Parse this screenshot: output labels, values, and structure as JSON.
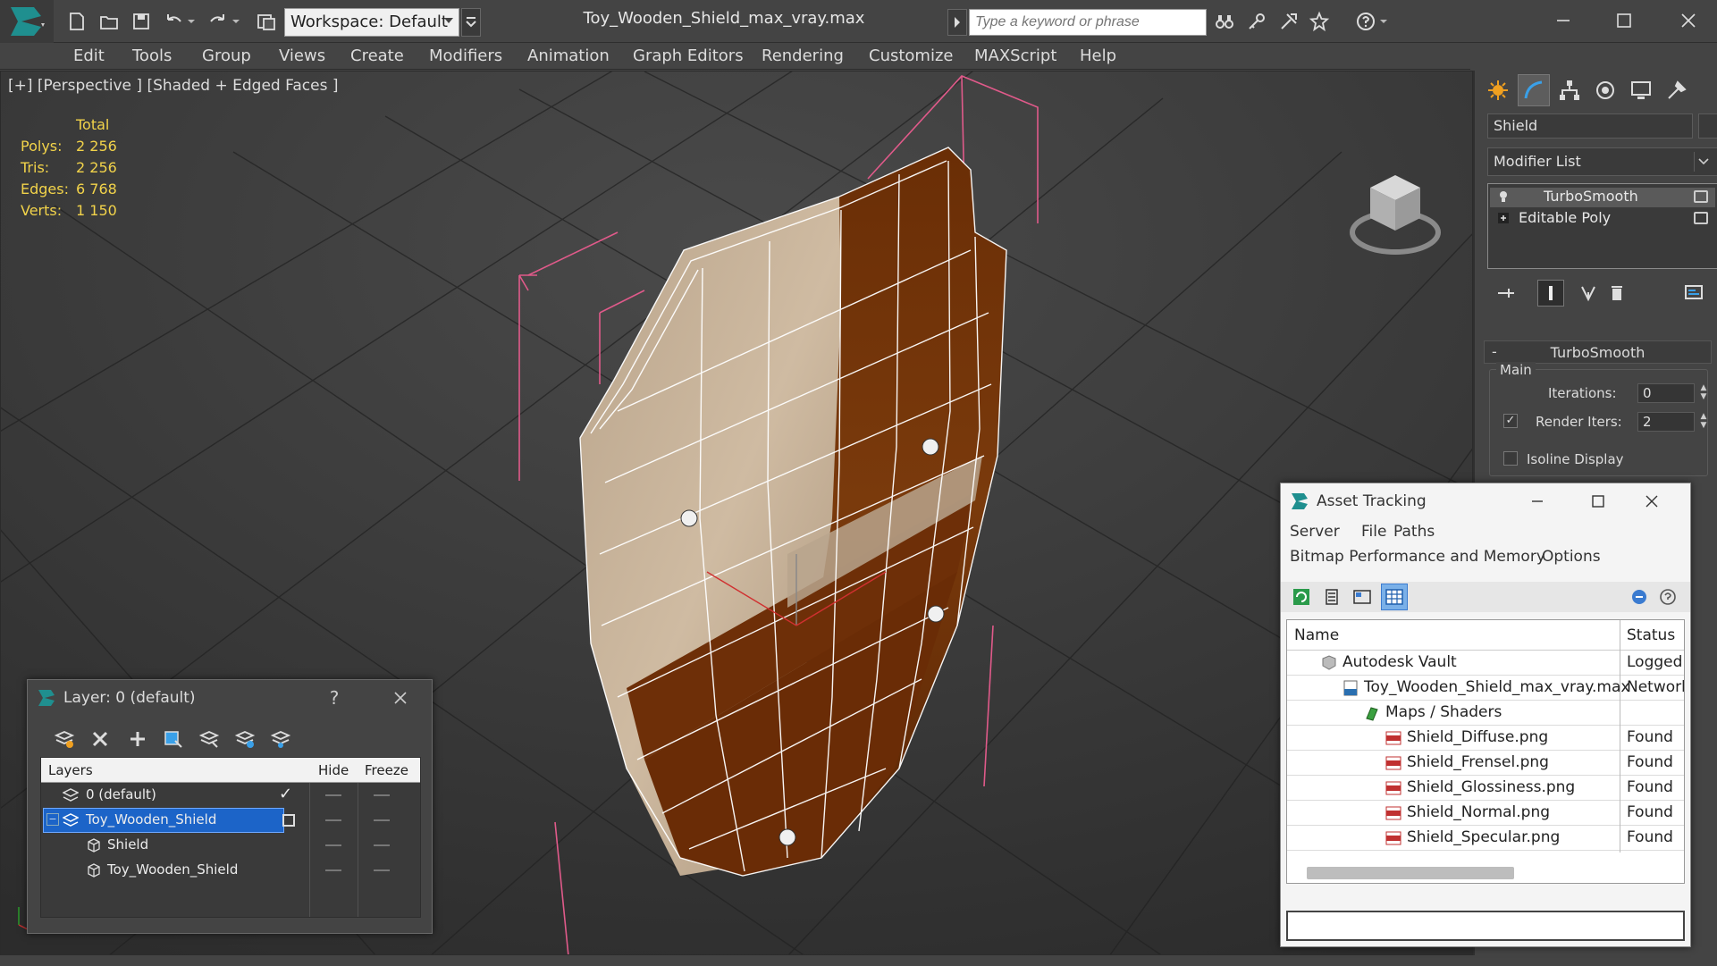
{
  "app": {
    "workspace_label": "Workspace: Default",
    "file_title": "Toy_Wooden_Shield_max_vray.max",
    "search_placeholder": "Type a keyword or phrase"
  },
  "menu": [
    "Edit",
    "Tools",
    "Group",
    "Views",
    "Create",
    "Modifiers",
    "Animation",
    "Graph Editors",
    "Rendering",
    "Customize",
    "MAXScript",
    "Help"
  ],
  "viewport": {
    "label": "[+] [Perspective ] [Shaded + Edged Faces ]",
    "stats_header": "Total",
    "stats": [
      {
        "key": "Polys:",
        "value": "2 256"
      },
      {
        "key": "Tris:",
        "value": "2 256"
      },
      {
        "key": "Edges:",
        "value": "6 768"
      },
      {
        "key": "Verts:",
        "value": "1 150"
      }
    ]
  },
  "command_panel": {
    "object_name": "Shield",
    "modifier_list": "Modifier List",
    "stack": [
      "TurboSmooth",
      "Editable Poly"
    ],
    "rollout_title": "TurboSmooth",
    "rollout_sign": "-",
    "group_main": "Main",
    "iterations_label": "Iterations:",
    "iterations_value": "0",
    "render_iters_label": "Render Iters:",
    "render_iters_value": "2",
    "render_iters_checked": "✓",
    "isoline_label": "Isoline Display"
  },
  "layer_dialog": {
    "title": "Layer: 0 (default)",
    "help": "?",
    "columns": {
      "layers": "Layers",
      "hide": "Hide",
      "freeze": "Freeze"
    },
    "rows": [
      {
        "name": "0 (default)",
        "active_mark": "✓"
      },
      {
        "name": "Toy_Wooden_Shield"
      },
      {
        "name": "Shield"
      },
      {
        "name": "Toy_Wooden_Shield"
      }
    ]
  },
  "asset_dialog": {
    "title": "Asset Tracking",
    "menu": [
      "Server",
      "File",
      "Paths",
      "Bitmap Performance and Memory",
      "Options"
    ],
    "columns": {
      "name": "Name",
      "status": "Status"
    },
    "rows": [
      {
        "name": "Autodesk Vault",
        "status": "Logged C",
        "icon": "vault-icon"
      },
      {
        "name": "Toy_Wooden_Shield_max_vray.max",
        "status": "Network",
        "icon": "max-file-icon"
      },
      {
        "name": "Maps / Shaders",
        "status": "",
        "icon": "maps-icon"
      },
      {
        "name": "Shield_Diffuse.png",
        "status": "Found",
        "icon": "png-icon"
      },
      {
        "name": "Shield_Frensel.png",
        "status": "Found",
        "icon": "png-icon"
      },
      {
        "name": "Shield_Glossiness.png",
        "status": "Found",
        "icon": "png-icon"
      },
      {
        "name": "Shield_Normal.png",
        "status": "Found",
        "icon": "png-icon"
      },
      {
        "name": "Shield_Specular.png",
        "status": "Found",
        "icon": "png-icon"
      }
    ]
  },
  "colors": {
    "stats_yellow": "#f2d34a",
    "selection_blue": "#1c64c8",
    "wood_light": "#c9b39a",
    "wood_dark": "#6e2f08"
  }
}
